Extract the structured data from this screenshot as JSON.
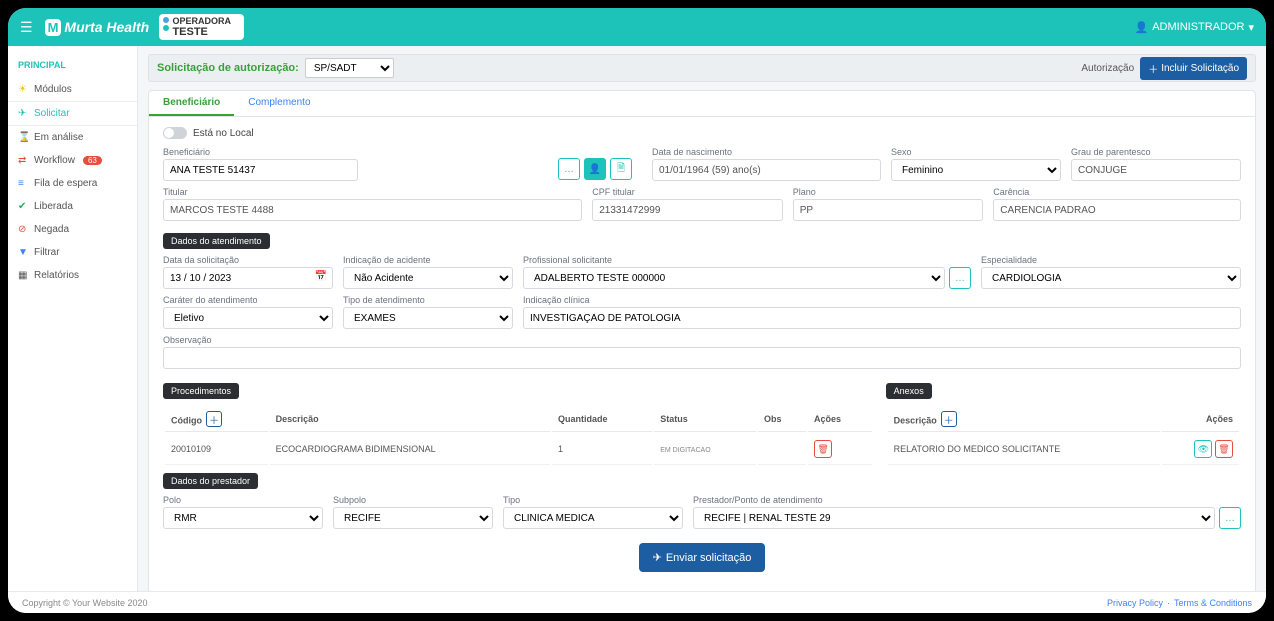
{
  "brand": {
    "name": "Murta Health",
    "operadora_top": "OPERADORA",
    "operadora_bottom": "TESTE"
  },
  "user": {
    "name": "ADMINISTRADOR"
  },
  "sidebar": {
    "header": "PRINCIPAL",
    "items": [
      {
        "label": "Módulos"
      },
      {
        "label": "Solicitar"
      },
      {
        "label": "Em análise"
      },
      {
        "label": "Workflow",
        "badge": "63"
      },
      {
        "label": "Fila de espera"
      },
      {
        "label": "Liberada"
      },
      {
        "label": "Negada"
      },
      {
        "label": "Filtrar"
      },
      {
        "label": "Relatórios"
      }
    ]
  },
  "toolbar": {
    "label": "Solicitação de autorização:",
    "select_value": "SP/SADT",
    "auth_label": "Autorização",
    "include_btn": "Incluir Solicitação"
  },
  "tabs": {
    "beneficiario": "Beneficiário",
    "complemento": "Complemento"
  },
  "toggle": {
    "label": "Está no Local"
  },
  "beneficiario": {
    "label_beneficiario": "Beneficiário",
    "value_beneficiario": "ANA TESTE 51437",
    "label_nascimento": "Data de nascimento",
    "value_nascimento": "01/01/1964 (59) ano(s)",
    "label_sexo": "Sexo",
    "value_sexo": "Feminino",
    "label_parentesco": "Grau de parentesco",
    "value_parentesco": "CONJUGE",
    "label_titular": "Titular",
    "value_titular": "MARCOS TESTE 4488",
    "label_cpf": "CPF titular",
    "value_cpf": "21331472999",
    "label_plano": "Plano",
    "value_plano": "PP",
    "label_carencia": "Carência",
    "value_carencia": "CARENCIA PADRAO"
  },
  "atendimento": {
    "section": "Dados do atendimento",
    "label_data": "Data da solicitação",
    "value_data": "13 / 10 / 2023",
    "label_acidente": "Indicação de acidente",
    "value_acidente": "Não Acidente",
    "label_profissional": "Profissional solicitante",
    "value_profissional": "ADALBERTO TESTE 000000",
    "label_especialidade": "Especialidade",
    "value_especialidade": "CARDIOLOGIA",
    "label_carater": "Caráter do atendimento",
    "value_carater": "Eletivo",
    "label_tipo": "Tipo de atendimento",
    "value_tipo": "EXAMES",
    "label_indicacao": "Indicação clínica",
    "value_indicacao": "INVESTIGAÇÃO DE PATOLOGIA",
    "label_obs": "Observação",
    "value_obs": ""
  },
  "procedimentos": {
    "section": "Procedimentos",
    "headers": {
      "codigo": "Código",
      "descricao": "Descrição",
      "quantidade": "Quantidade",
      "status": "Status",
      "obs": "Obs",
      "acoes": "Ações"
    },
    "rows": [
      {
        "codigo": "20010109",
        "descricao": "ECOCARDIOGRAMA BIDIMENSIONAL",
        "quantidade": "1",
        "status": "EM DIGITACAO",
        "obs": ""
      }
    ]
  },
  "anexos": {
    "section": "Anexos",
    "headers": {
      "descricao": "Descrição",
      "acoes": "Ações"
    },
    "rows": [
      {
        "descricao": "RELATORIO DO MEDICO SOLICITANTE"
      }
    ]
  },
  "prestador": {
    "section": "Dados do prestador",
    "label_polo": "Polo",
    "value_polo": "RMR",
    "label_subpolo": "Subpolo",
    "value_subpolo": "RECIFE",
    "label_tipo": "Tipo",
    "value_tipo": "CLINICA MEDICA",
    "label_ponto": "Prestador/Ponto de atendimento",
    "value_ponto": "RECIFE | RENAL TESTE 29"
  },
  "submit": {
    "label": "Enviar solicitação"
  },
  "footer": {
    "copyright": "Copyright © Your Website 2020",
    "privacy": "Privacy Policy",
    "sep": "·",
    "terms": "Terms & Conditions"
  }
}
